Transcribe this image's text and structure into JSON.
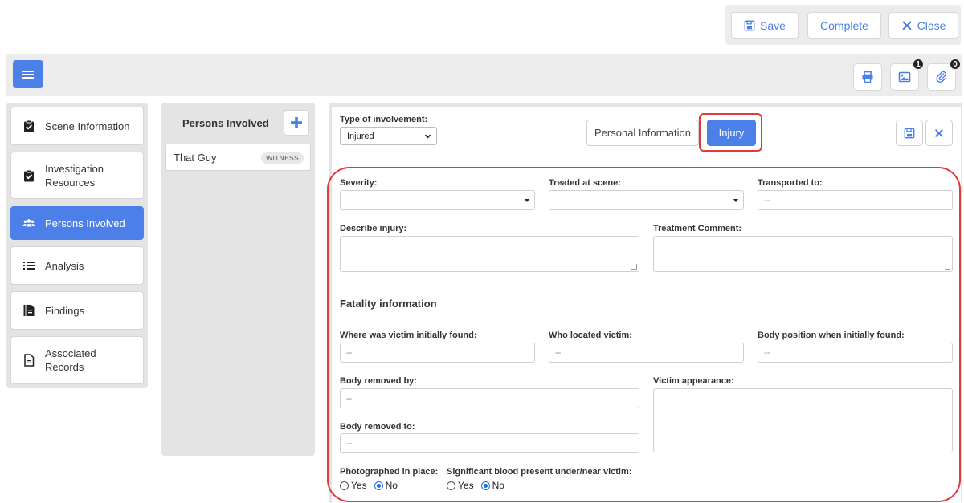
{
  "toolbar": {
    "save_label": "Save",
    "complete_label": "Complete",
    "close_label": "Close",
    "images_count": "1",
    "attachments_count": "0"
  },
  "nav": {
    "items": [
      {
        "label": "Scene Information",
        "icon": "clipboard-check-icon"
      },
      {
        "label": "Investigation Resources",
        "icon": "clipboard-check-icon"
      },
      {
        "label": "Persons Involved",
        "icon": "users-icon",
        "active": true
      },
      {
        "label": "Analysis",
        "icon": "list-icon"
      },
      {
        "label": "Findings",
        "icon": "report-icon"
      },
      {
        "label": "Associated Records",
        "icon": "document-icon"
      }
    ]
  },
  "persons": {
    "title": "Persons Involved",
    "list": [
      {
        "name": "That Guy",
        "role": "WITNESS"
      }
    ]
  },
  "form": {
    "involvement_label": "Type of involvement:",
    "involvement_value": "Injured",
    "tabs": {
      "personal": "Personal Information",
      "injury": "Injury"
    },
    "severity_label": "Severity:",
    "treated_label": "Treated at scene:",
    "transported_label": "Transported to:",
    "transported_placeholder": "--",
    "describe_label": "Describe injury:",
    "treatment_comment_label": "Treatment Comment:",
    "fatality_title": "Fatality information",
    "found_where_label": "Where was victim initially found:",
    "found_where_placeholder": "--",
    "located_by_label": "Who located victim:",
    "located_by_placeholder": "--",
    "position_label": "Body position when initially found:",
    "position_placeholder": "--",
    "removed_by_label": "Body removed by:",
    "removed_by_placeholder": "--",
    "appearance_label": "Victim appearance:",
    "removed_to_label": "Body removed to:",
    "removed_to_placeholder": "--",
    "photographed_label": "Photographed in place:",
    "blood_label": "Significant blood present under/near victim:",
    "yes_label": "Yes",
    "no_label": "No",
    "photographed_value": "No",
    "blood_value": "No"
  },
  "colors": {
    "accent": "#4c7fe8",
    "highlight": "#e0393e"
  }
}
